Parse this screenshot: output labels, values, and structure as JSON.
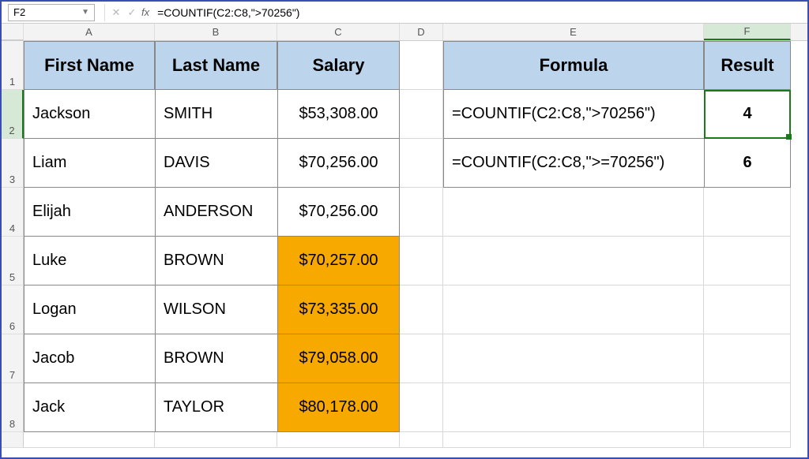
{
  "nameBox": "F2",
  "formulaInput": "=COUNTIF(C2:C8,\">70256\")",
  "columns": [
    "A",
    "B",
    "C",
    "D",
    "E",
    "F"
  ],
  "rowNums": [
    "1",
    "2",
    "3",
    "4",
    "5",
    "6",
    "7",
    "8"
  ],
  "headers": {
    "firstName": "First Name",
    "lastName": "Last Name",
    "salary": "Salary",
    "formula": "Formula",
    "result": "Result"
  },
  "data": [
    {
      "first": "Jackson",
      "last": "SMITH",
      "salary": "$53,308.00",
      "hl": false
    },
    {
      "first": "Liam",
      "last": "DAVIS",
      "salary": "$70,256.00",
      "hl": false
    },
    {
      "first": "Elijah",
      "last": "ANDERSON",
      "salary": "$70,256.00",
      "hl": false
    },
    {
      "first": "Luke",
      "last": "BROWN",
      "salary": "$70,257.00",
      "hl": true
    },
    {
      "first": "Logan",
      "last": "WILSON",
      "salary": "$73,335.00",
      "hl": true
    },
    {
      "first": "Jacob",
      "last": "BROWN",
      "salary": "$79,058.00",
      "hl": true
    },
    {
      "first": "Jack",
      "last": "TAYLOR",
      "salary": "$80,178.00",
      "hl": true
    }
  ],
  "formulaRows": [
    {
      "formula": "=COUNTIF(C2:C8,\">70256\")",
      "result": "4"
    },
    {
      "formula": "=COUNTIF(C2:C8,\">=70256\")",
      "result": "6"
    }
  ],
  "activeCell": "F2"
}
